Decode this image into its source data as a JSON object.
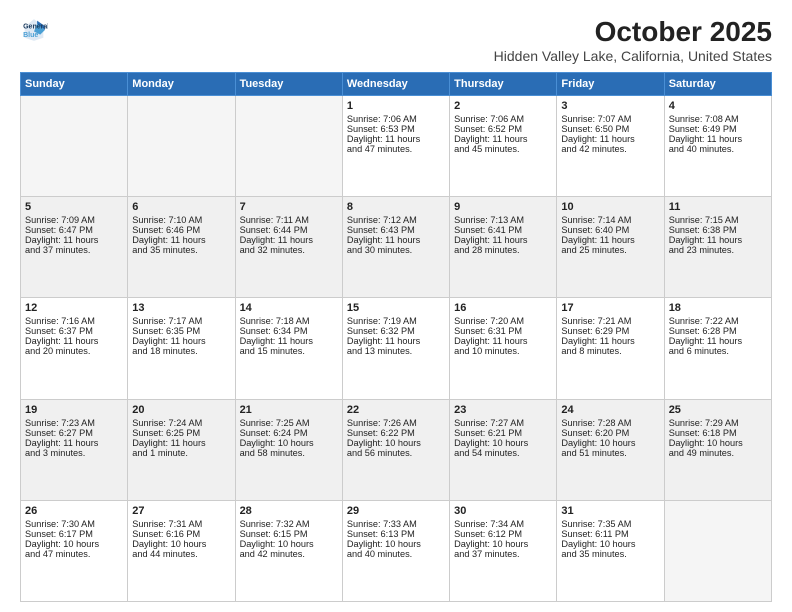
{
  "logo": {
    "line1": "General",
    "line2": "Blue"
  },
  "header": {
    "month": "October 2025",
    "location": "Hidden Valley Lake, California, United States"
  },
  "days_of_week": [
    "Sunday",
    "Monday",
    "Tuesday",
    "Wednesday",
    "Thursday",
    "Friday",
    "Saturday"
  ],
  "weeks": [
    [
      {
        "day": "",
        "content": ""
      },
      {
        "day": "",
        "content": ""
      },
      {
        "day": "",
        "content": ""
      },
      {
        "day": "1",
        "content": "Sunrise: 7:06 AM\nSunset: 6:53 PM\nDaylight: 11 hours\nand 47 minutes."
      },
      {
        "day": "2",
        "content": "Sunrise: 7:06 AM\nSunset: 6:52 PM\nDaylight: 11 hours\nand 45 minutes."
      },
      {
        "day": "3",
        "content": "Sunrise: 7:07 AM\nSunset: 6:50 PM\nDaylight: 11 hours\nand 42 minutes."
      },
      {
        "day": "4",
        "content": "Sunrise: 7:08 AM\nSunset: 6:49 PM\nDaylight: 11 hours\nand 40 minutes."
      }
    ],
    [
      {
        "day": "5",
        "content": "Sunrise: 7:09 AM\nSunset: 6:47 PM\nDaylight: 11 hours\nand 37 minutes."
      },
      {
        "day": "6",
        "content": "Sunrise: 7:10 AM\nSunset: 6:46 PM\nDaylight: 11 hours\nand 35 minutes."
      },
      {
        "day": "7",
        "content": "Sunrise: 7:11 AM\nSunset: 6:44 PM\nDaylight: 11 hours\nand 32 minutes."
      },
      {
        "day": "8",
        "content": "Sunrise: 7:12 AM\nSunset: 6:43 PM\nDaylight: 11 hours\nand 30 minutes."
      },
      {
        "day": "9",
        "content": "Sunrise: 7:13 AM\nSunset: 6:41 PM\nDaylight: 11 hours\nand 28 minutes."
      },
      {
        "day": "10",
        "content": "Sunrise: 7:14 AM\nSunset: 6:40 PM\nDaylight: 11 hours\nand 25 minutes."
      },
      {
        "day": "11",
        "content": "Sunrise: 7:15 AM\nSunset: 6:38 PM\nDaylight: 11 hours\nand 23 minutes."
      }
    ],
    [
      {
        "day": "12",
        "content": "Sunrise: 7:16 AM\nSunset: 6:37 PM\nDaylight: 11 hours\nand 20 minutes."
      },
      {
        "day": "13",
        "content": "Sunrise: 7:17 AM\nSunset: 6:35 PM\nDaylight: 11 hours\nand 18 minutes."
      },
      {
        "day": "14",
        "content": "Sunrise: 7:18 AM\nSunset: 6:34 PM\nDaylight: 11 hours\nand 15 minutes."
      },
      {
        "day": "15",
        "content": "Sunrise: 7:19 AM\nSunset: 6:32 PM\nDaylight: 11 hours\nand 13 minutes."
      },
      {
        "day": "16",
        "content": "Sunrise: 7:20 AM\nSunset: 6:31 PM\nDaylight: 11 hours\nand 10 minutes."
      },
      {
        "day": "17",
        "content": "Sunrise: 7:21 AM\nSunset: 6:29 PM\nDaylight: 11 hours\nand 8 minutes."
      },
      {
        "day": "18",
        "content": "Sunrise: 7:22 AM\nSunset: 6:28 PM\nDaylight: 11 hours\nand 6 minutes."
      }
    ],
    [
      {
        "day": "19",
        "content": "Sunrise: 7:23 AM\nSunset: 6:27 PM\nDaylight: 11 hours\nand 3 minutes."
      },
      {
        "day": "20",
        "content": "Sunrise: 7:24 AM\nSunset: 6:25 PM\nDaylight: 11 hours\nand 1 minute."
      },
      {
        "day": "21",
        "content": "Sunrise: 7:25 AM\nSunset: 6:24 PM\nDaylight: 10 hours\nand 58 minutes."
      },
      {
        "day": "22",
        "content": "Sunrise: 7:26 AM\nSunset: 6:22 PM\nDaylight: 10 hours\nand 56 minutes."
      },
      {
        "day": "23",
        "content": "Sunrise: 7:27 AM\nSunset: 6:21 PM\nDaylight: 10 hours\nand 54 minutes."
      },
      {
        "day": "24",
        "content": "Sunrise: 7:28 AM\nSunset: 6:20 PM\nDaylight: 10 hours\nand 51 minutes."
      },
      {
        "day": "25",
        "content": "Sunrise: 7:29 AM\nSunset: 6:18 PM\nDaylight: 10 hours\nand 49 minutes."
      }
    ],
    [
      {
        "day": "26",
        "content": "Sunrise: 7:30 AM\nSunset: 6:17 PM\nDaylight: 10 hours\nand 47 minutes."
      },
      {
        "day": "27",
        "content": "Sunrise: 7:31 AM\nSunset: 6:16 PM\nDaylight: 10 hours\nand 44 minutes."
      },
      {
        "day": "28",
        "content": "Sunrise: 7:32 AM\nSunset: 6:15 PM\nDaylight: 10 hours\nand 42 minutes."
      },
      {
        "day": "29",
        "content": "Sunrise: 7:33 AM\nSunset: 6:13 PM\nDaylight: 10 hours\nand 40 minutes."
      },
      {
        "day": "30",
        "content": "Sunrise: 7:34 AM\nSunset: 6:12 PM\nDaylight: 10 hours\nand 37 minutes."
      },
      {
        "day": "31",
        "content": "Sunrise: 7:35 AM\nSunset: 6:11 PM\nDaylight: 10 hours\nand 35 minutes."
      },
      {
        "day": "",
        "content": ""
      }
    ]
  ]
}
